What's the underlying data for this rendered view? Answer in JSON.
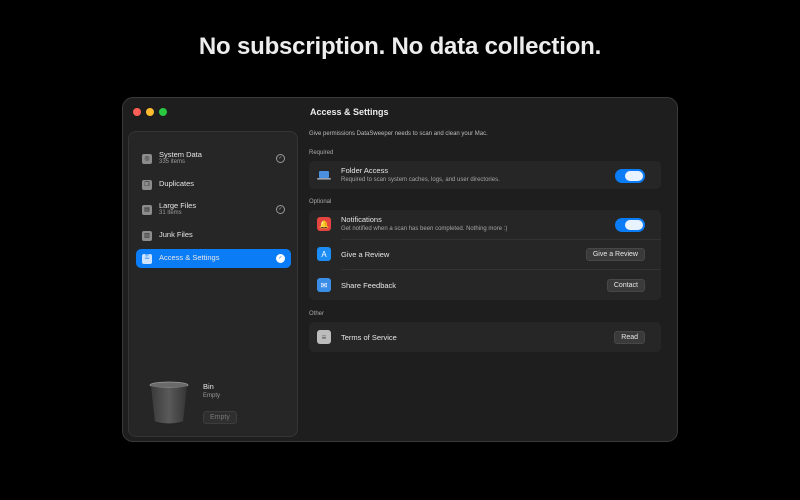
{
  "headline": "No subscription. No data collection.",
  "window": {
    "title": "Access & Settings"
  },
  "sidebar": {
    "items": [
      {
        "label": "System Data",
        "sub": "335 items",
        "icon": "disk-icon",
        "checked": true
      },
      {
        "label": "Duplicates",
        "sub": "",
        "icon": "duplicates-icon",
        "checked": false
      },
      {
        "label": "Large Files",
        "sub": "31 items",
        "icon": "large-files-icon",
        "checked": true
      },
      {
        "label": "Junk Files",
        "sub": "",
        "icon": "junk-icon",
        "checked": false
      },
      {
        "label": "Access & Settings",
        "sub": "",
        "icon": "lock-icon",
        "checked": true,
        "active": true
      }
    ],
    "bin": {
      "title": "Bin",
      "status": "Empty",
      "button": "Empty"
    }
  },
  "content": {
    "description": "Give permissions DataSweeper needs to scan and clean your Mac.",
    "required_label": "Required",
    "folder_access": {
      "title": "Folder Access",
      "sub": "Required to scan system caches, logs, and user directories.",
      "enabled": true
    },
    "optional_label": "Optional",
    "notifications": {
      "title": "Notifications",
      "sub": "Get notified when a scan has been completed. Nothing more :)",
      "enabled": true
    },
    "review": {
      "title": "Give a Review",
      "button": "Give a Review"
    },
    "feedback": {
      "title": "Share Feedback",
      "button": "Contact"
    },
    "other_label": "Other",
    "terms": {
      "title": "Terms of Service",
      "button": "Read"
    }
  },
  "colors": {
    "accent": "#0a7cf5",
    "background": "#000000",
    "window": "#1e1e1e"
  }
}
